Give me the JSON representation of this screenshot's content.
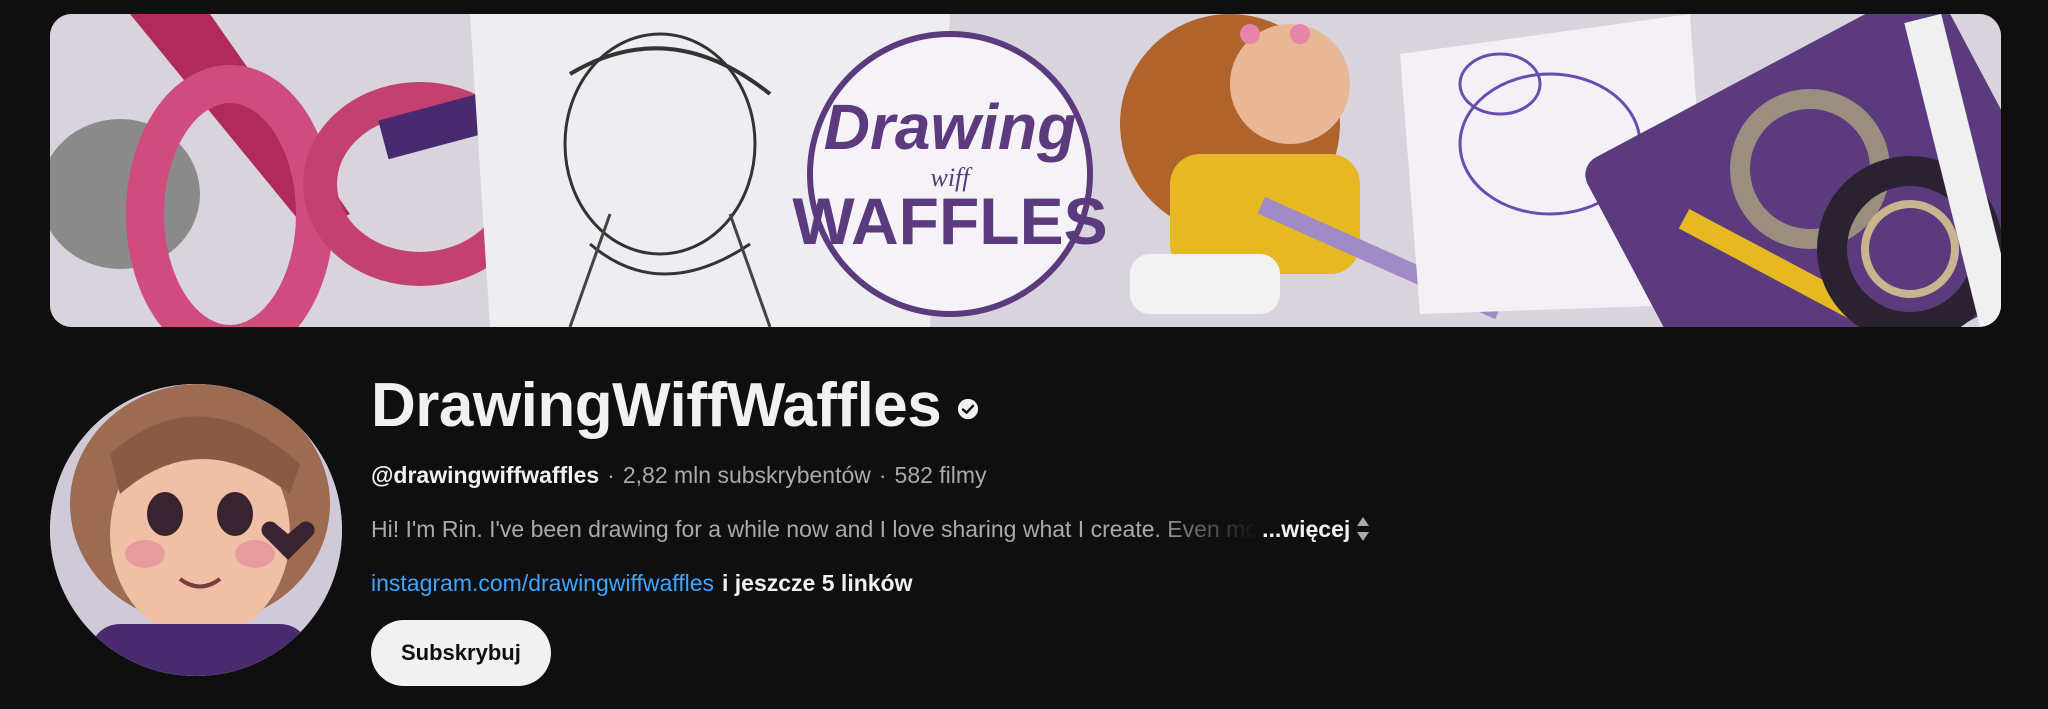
{
  "banner": {
    "logo_line1": "Drawing",
    "logo_line2": "wiff",
    "logo_line3": "WAFFLES",
    "palette": {
      "bg": "#d9d3de",
      "purple": "#5b3b7e",
      "pink": "#c2416e",
      "yellow": "#e6b922"
    }
  },
  "channel": {
    "title": "DrawingWiffWaffles",
    "verified_icon": "verified-check-icon",
    "handle": "@drawingwiffwaffles",
    "subscribers": "2,82 mln subskrybentów",
    "videos": "582 filmy",
    "separator": "·",
    "description": "Hi! I'm Rin. I've been drawing for a while now and I love sharing what I create. Even mo",
    "more_label": "...więcej",
    "link_text": "instagram.com/drawingwiffwaffles",
    "more_links_label": "i jeszcze 5 linków",
    "subscribe_label": "Subskrybuj"
  },
  "colors": {
    "background": "#0f0f0f",
    "text_primary": "#f1f1f1",
    "text_secondary": "#aaaaaa",
    "link": "#3ea6ff"
  }
}
